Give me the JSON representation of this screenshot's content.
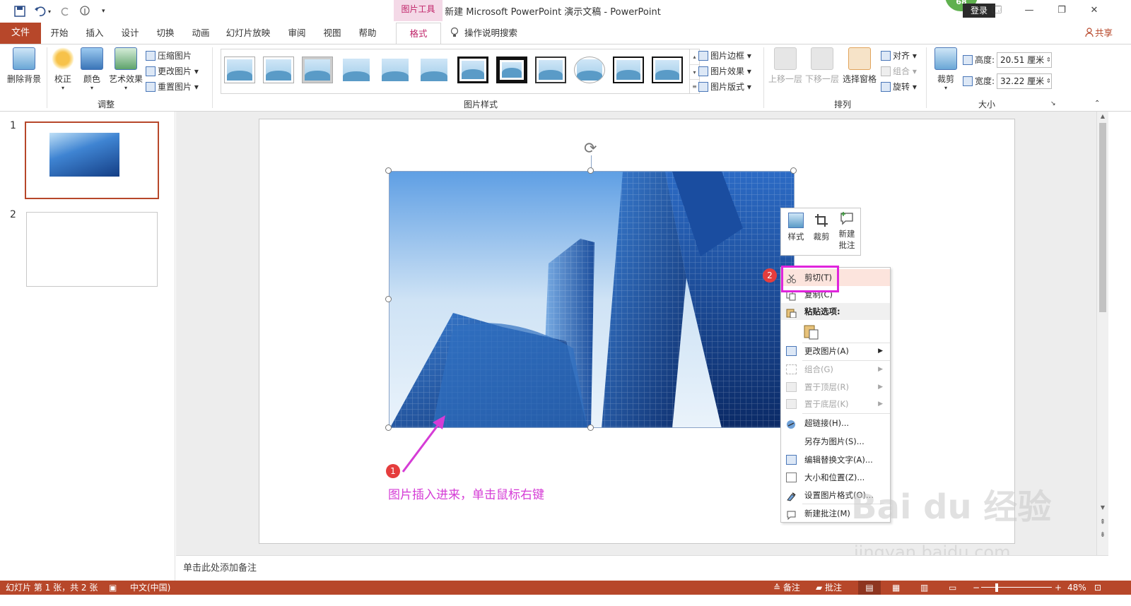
{
  "quick_access": {
    "save_icon": "save-icon",
    "undo_icon": "undo-icon",
    "redo_icon": "redo-icon",
    "touch_icon": "touch-mode-icon",
    "customize": "▾"
  },
  "context_tab": "图片工具",
  "title": "新建 Microsoft PowerPoint 演示文稿  -  PowerPoint",
  "badge": "68",
  "login": "登录",
  "window_buttons": [
    "🗔",
    "—",
    "❐",
    "✕"
  ],
  "tabs": {
    "file": "文件",
    "items": [
      "开始",
      "插入",
      "设计",
      "切换",
      "动画",
      "幻灯片放映",
      "审阅",
      "视图",
      "帮助"
    ],
    "format": "格式",
    "tell_me": "操作说明搜索",
    "share": "共享"
  },
  "ribbon": {
    "adjust": {
      "remove_bg": "删除背景",
      "corrections": "校正",
      "color": "颜色",
      "artistic": "艺术效果",
      "compress": "压缩图片",
      "change": "更改图片",
      "reset": "重置图片",
      "label": "调整"
    },
    "styles": {
      "border": "图片边框",
      "effects": "图片效果",
      "layout": "图片版式",
      "label": "图片样式"
    },
    "arrange": {
      "forward": "上移一层",
      "backward": "下移一层",
      "selection": "选择窗格",
      "align": "对齐",
      "group": "组合",
      "rotate": "旋转",
      "label": "排列"
    },
    "size": {
      "crop": "裁剪",
      "height_label": "高度:",
      "height_value": "20.51 厘米",
      "width_label": "宽度:",
      "width_value": "32.22 厘米",
      "label": "大小"
    }
  },
  "slides": [
    {
      "num": "1"
    },
    {
      "num": "2"
    }
  ],
  "mini_toolbar": {
    "style": "样式",
    "crop": "裁剪",
    "comment_1": "新建",
    "comment_2": "批注"
  },
  "context_menu": {
    "cut": "剪切(T)",
    "copy": "复制(C)",
    "paste_options": "粘贴选项:",
    "change_picture": "更改图片(A)",
    "group": "组合(G)",
    "bring_front": "置于顶层(R)",
    "send_back": "置于底层(K)",
    "hyperlink": "超链接(H)...",
    "save_as": "另存为图片(S)...",
    "alt_text": "编辑替换文字(A)...",
    "size_pos": "大小和位置(Z)...",
    "format": "设置图片格式(O)...",
    "new_comment": "新建批注(M)"
  },
  "annotation": {
    "step1": "1",
    "step2": "2",
    "text": "图片插入进来，单击鼠标右键"
  },
  "notes_placeholder": "单击此处添加备注",
  "status": {
    "slide_info": "幻灯片 第 1 张，共 2 张",
    "language": "中文(中国)",
    "notes": "备注",
    "comments": "批注",
    "zoom": "48%"
  },
  "watermark": {
    "main": "Bai du 经验",
    "sub": "jingyan.baidu.com"
  },
  "colors": {
    "accent": "#b7472a",
    "context": "#c0256a",
    "annotation": "#d53cd6",
    "highlight": "#e024dc"
  }
}
